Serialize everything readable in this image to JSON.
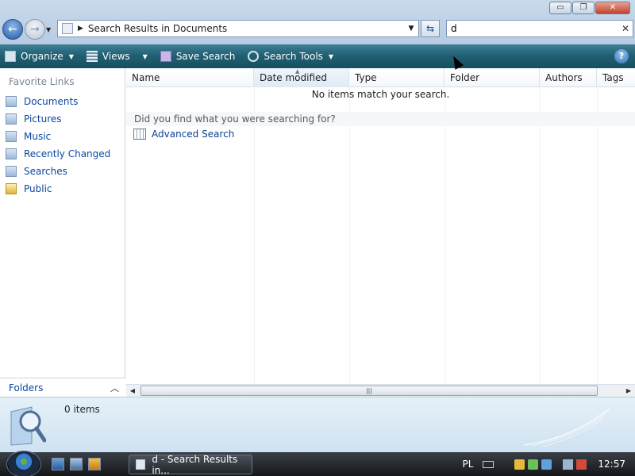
{
  "window": {
    "minimize_label": "▭",
    "maximize_label": "❐",
    "close_label": "✕"
  },
  "address_bar": {
    "path": "Search Results in Documents"
  },
  "search": {
    "value": "d",
    "clear_label": "✕"
  },
  "toolbar": {
    "organize_label": "Organize",
    "views_label": "Views",
    "save_search_label": "Save Search",
    "search_tools_label": "Search Tools",
    "help_label": "?"
  },
  "left_pane": {
    "title": "Favorite Links",
    "items": [
      {
        "label": "Documents",
        "icon": "documents-icon"
      },
      {
        "label": "Pictures",
        "icon": "pictures-icon"
      },
      {
        "label": "Music",
        "icon": "music-icon"
      },
      {
        "label": "Recently Changed",
        "icon": "recently-changed-icon"
      },
      {
        "label": "Searches",
        "icon": "searches-icon"
      },
      {
        "label": "Public",
        "icon": "public-folder-icon"
      }
    ],
    "folders_label": "Folders"
  },
  "columns": [
    "Name",
    "Date modified",
    "Type",
    "Folder",
    "Authors",
    "Tags"
  ],
  "content": {
    "empty_message": "No items match your search.",
    "hint": "Did you find what you were searching for?",
    "advanced_search_label": "Advanced Search"
  },
  "details": {
    "count": "0 items"
  },
  "taskbar": {
    "task_label": "d - Search Results in...",
    "language": "PL",
    "clock": "12:57"
  }
}
